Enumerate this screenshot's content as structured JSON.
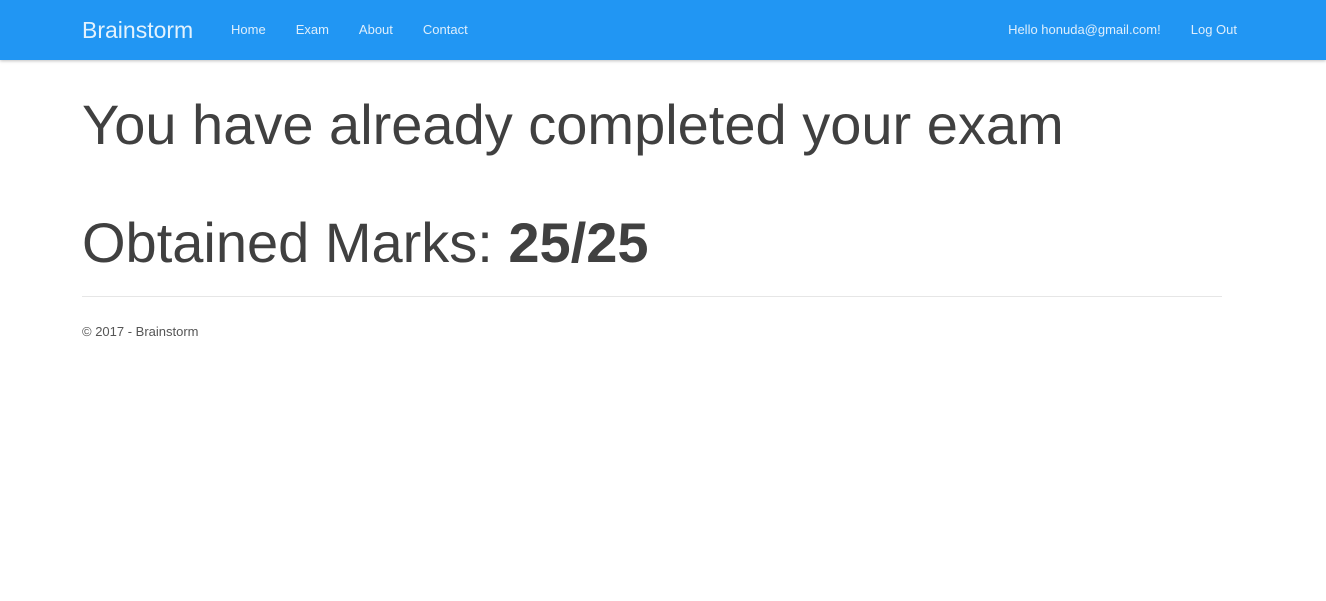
{
  "navbar": {
    "brand": "Brainstorm",
    "links": [
      {
        "label": "Home"
      },
      {
        "label": "Exam"
      },
      {
        "label": "About"
      },
      {
        "label": "Contact"
      }
    ],
    "user_greeting": "Hello honuda@gmail.com!",
    "logout_label": "Log Out",
    "background_color": "#2196f3"
  },
  "main": {
    "title": "You have already completed your exam",
    "marks_label": "Obtained Marks:",
    "marks_value": "25/25"
  },
  "footer": {
    "text": "© 2017 - Brainstorm"
  }
}
